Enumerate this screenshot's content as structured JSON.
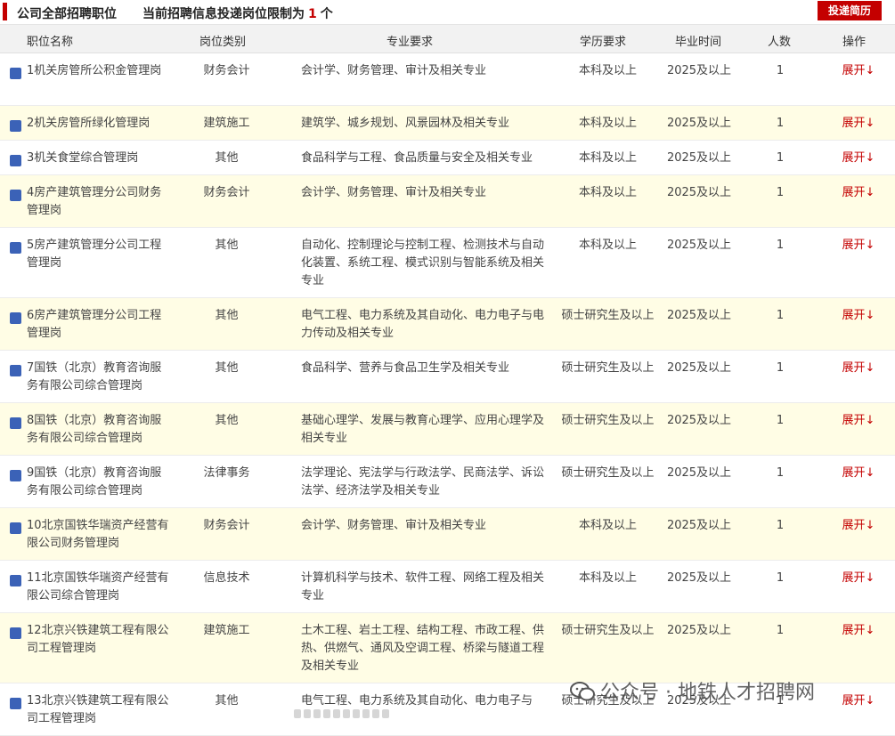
{
  "header": {
    "title": "公司全部招聘职位",
    "limit_prefix": "当前招聘信息投递岗位限制为",
    "limit_value": "1",
    "limit_suffix": "个",
    "apply_button": "投递简历"
  },
  "columns": {
    "name": "职位名称",
    "type": "岗位类别",
    "major": "专业要求",
    "education": "学历要求",
    "graduation": "毕业时间",
    "count": "人数",
    "action": "操作"
  },
  "rows": [
    {
      "name": "1机关房管所公积金管理岗",
      "type": "财务会计",
      "major": "会计学、财务管理、审计及相关专业",
      "education": "本科及以上",
      "graduation": "2025及以上",
      "count": "1",
      "action": "展开↓"
    },
    {
      "name": "2机关房管所绿化管理岗",
      "type": "建筑施工",
      "major": "建筑学、城乡规划、风景园林及相关专业",
      "education": "本科及以上",
      "graduation": "2025及以上",
      "count": "1",
      "action": "展开↓"
    },
    {
      "name": "3机关食堂综合管理岗",
      "type": "其他",
      "major": "食品科学与工程、食品质量与安全及相关专业",
      "education": "本科及以上",
      "graduation": "2025及以上",
      "count": "1",
      "action": "展开↓"
    },
    {
      "name": "4房产建筑管理分公司财务管理岗",
      "type": "财务会计",
      "major": "会计学、财务管理、审计及相关专业",
      "education": "本科及以上",
      "graduation": "2025及以上",
      "count": "1",
      "action": "展开↓"
    },
    {
      "name": "5房产建筑管理分公司工程管理岗",
      "type": "其他",
      "major": "自动化、控制理论与控制工程、检测技术与自动化装置、系统工程、模式识别与智能系统及相关专业",
      "education": "本科及以上",
      "graduation": "2025及以上",
      "count": "1",
      "action": "展开↓"
    },
    {
      "name": "6房产建筑管理分公司工程管理岗",
      "type": "其他",
      "major": "电气工程、电力系统及其自动化、电力电子与电力传动及相关专业",
      "education": "硕士研究生及以上",
      "graduation": "2025及以上",
      "count": "1",
      "action": "展开↓"
    },
    {
      "name": "7国铁（北京）教育咨询服务有限公司综合管理岗",
      "type": "其他",
      "major": "食品科学、营养与食品卫生学及相关专业",
      "education": "硕士研究生及以上",
      "graduation": "2025及以上",
      "count": "1",
      "action": "展开↓"
    },
    {
      "name": "8国铁（北京）教育咨询服务有限公司综合管理岗",
      "type": "其他",
      "major": "基础心理学、发展与教育心理学、应用心理学及相关专业",
      "education": "硕士研究生及以上",
      "graduation": "2025及以上",
      "count": "1",
      "action": "展开↓"
    },
    {
      "name": "9国铁（北京）教育咨询服务有限公司综合管理岗",
      "type": "法律事务",
      "major": "法学理论、宪法学与行政法学、民商法学、诉讼法学、经济法学及相关专业",
      "education": "硕士研究生及以上",
      "graduation": "2025及以上",
      "count": "1",
      "action": "展开↓"
    },
    {
      "name": "10北京国铁华瑞资产经营有限公司财务管理岗",
      "type": "财务会计",
      "major": "会计学、财务管理、审计及相关专业",
      "education": "本科及以上",
      "graduation": "2025及以上",
      "count": "1",
      "action": "展开↓"
    },
    {
      "name": "11北京国铁华瑞资产经营有限公司综合管理岗",
      "type": "信息技术",
      "major": "计算机科学与技术、软件工程、网络工程及相关专业",
      "education": "本科及以上",
      "graduation": "2025及以上",
      "count": "1",
      "action": "展开↓"
    },
    {
      "name": "12北京兴铁建筑工程有限公司工程管理岗",
      "type": "建筑施工",
      "major": "土木工程、岩土工程、结构工程、市政工程、供热、供燃气、通风及空调工程、桥梁与隧道工程及相关专业",
      "education": "硕士研究生及以上",
      "graduation": "2025及以上",
      "count": "1",
      "action": "展开↓"
    },
    {
      "name": "13北京兴铁建筑工程有限公司工程管理岗",
      "type": "其他",
      "major": "电气工程、电力系统及其自动化、电力电子与",
      "education": "硕士研究生及以上",
      "graduation": "2025及以上",
      "count": "1",
      "action": "展开↓"
    }
  ],
  "watermark": "公众号 · 地铁人才招聘网",
  "colors": {
    "accent": "#c40000",
    "row_alt": "#fffde5",
    "checkbox": "#3b62b7",
    "header_bg": "#f2f2f2"
  }
}
